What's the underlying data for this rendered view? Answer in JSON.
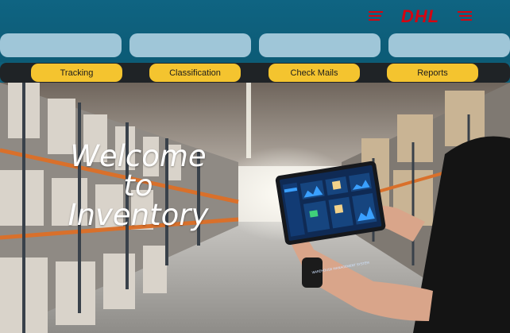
{
  "brand": {
    "logo_text": "DHL",
    "logo_color": "#d40511",
    "logo_bg": "#0f6482"
  },
  "header": {
    "slots": [
      "",
      "",
      "",
      ""
    ]
  },
  "nav": {
    "items": [
      {
        "label": "Tracking"
      },
      {
        "label": "Classification"
      },
      {
        "label": "Check Mails"
      },
      {
        "label": "Reports"
      }
    ],
    "button_color": "#f4c42f"
  },
  "hero": {
    "welcome_line1": "Welcome",
    "welcome_line2": "to",
    "welcome_line3": "Inventory",
    "tablet_title": "WAREHOUSE MANAGEMENT SYSTEM"
  }
}
